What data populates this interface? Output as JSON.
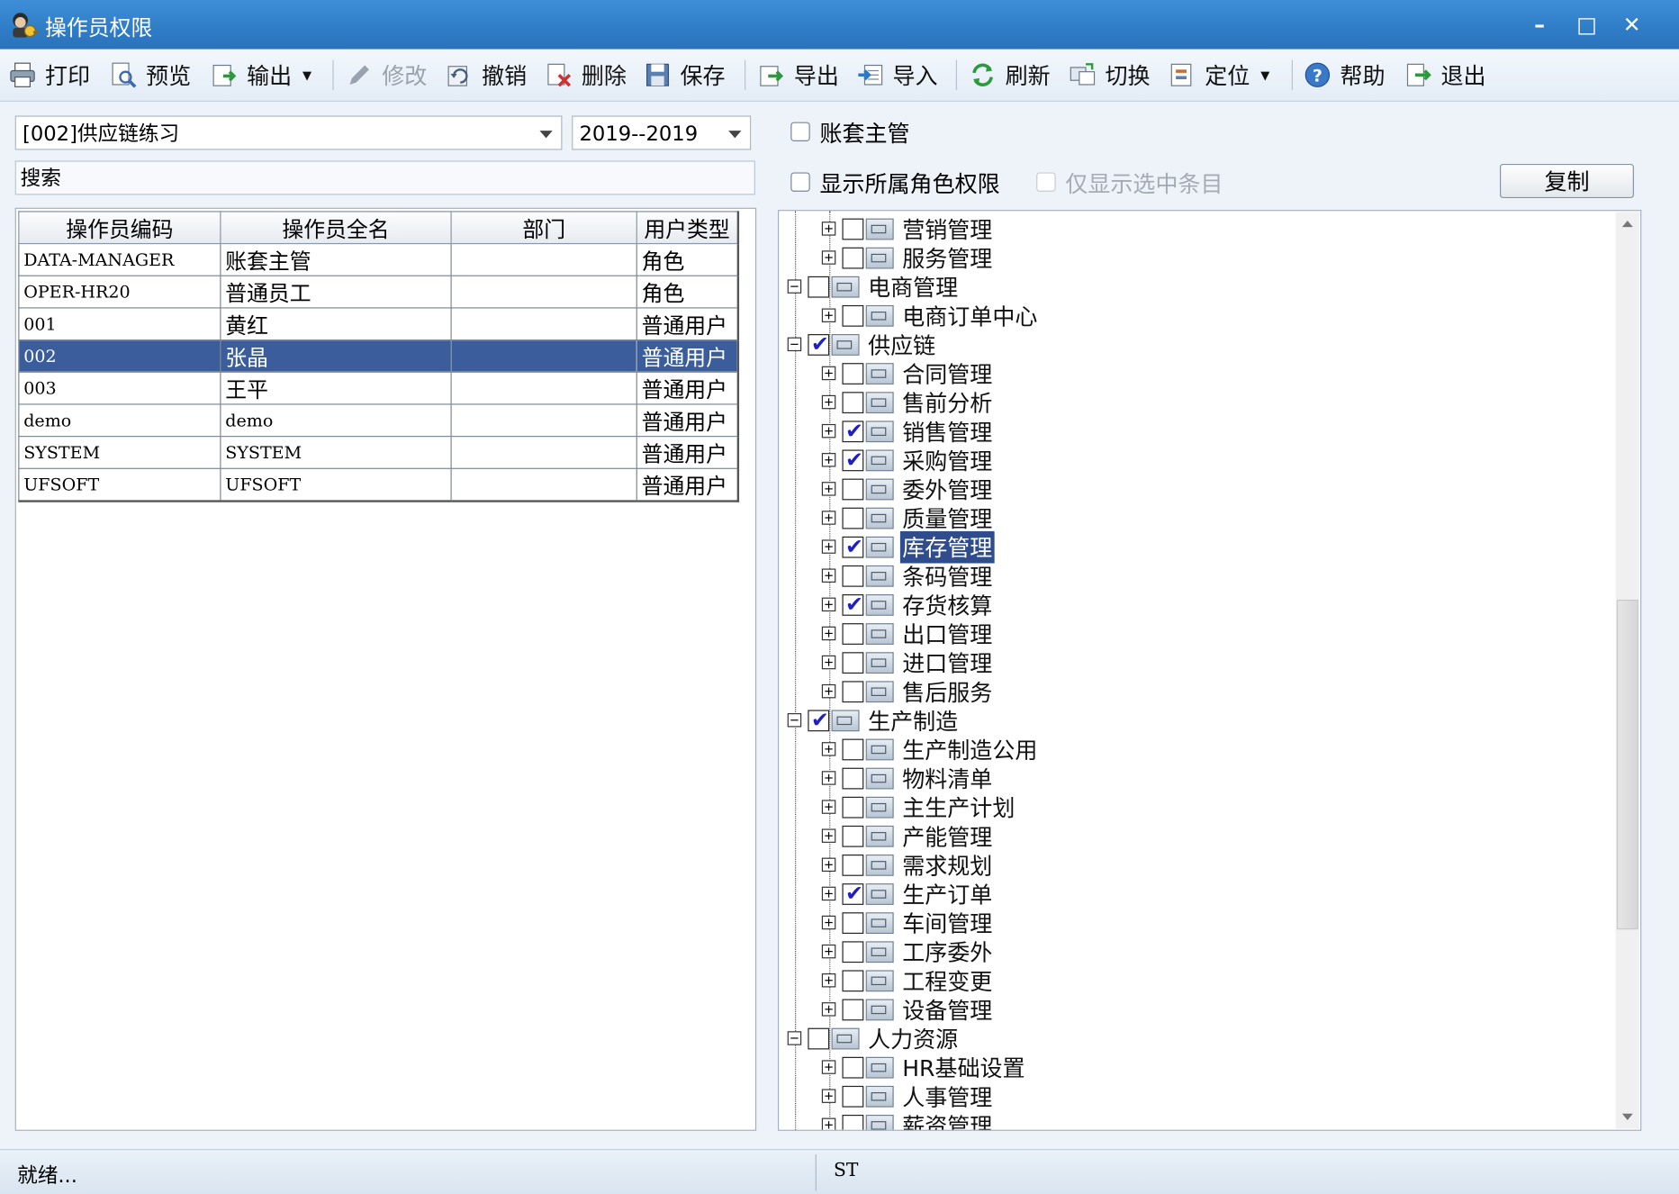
{
  "window": {
    "title": "操作员权限"
  },
  "window_buttons": {
    "minimize": "–",
    "maximize": "□",
    "close": "✕"
  },
  "toolbar": {
    "print": "打印",
    "preview": "预览",
    "output": "输出",
    "modify": "修改",
    "undo": "撤销",
    "delete": "删除",
    "save": "保存",
    "export": "导出",
    "import": "导入",
    "refresh": "刷新",
    "switch": "切换",
    "locate": "定位",
    "help": "帮助",
    "exit": "退出"
  },
  "filters": {
    "account": "[002]供应链练习",
    "year": "2019--2019",
    "search_placeholder": "搜索"
  },
  "options": {
    "account_supervisor": "账套主管",
    "show_role_permissions": "显示所属角色权限",
    "show_selected_only": "仅显示选中条目",
    "copy_button": "复制"
  },
  "table": {
    "headers": [
      "操作员编码",
      "操作员全名",
      "部门",
      "用户类型"
    ],
    "rows": [
      [
        "DATA-MANAGER",
        "账套主管",
        "",
        "角色"
      ],
      [
        "OPER-HR20",
        "普通员工",
        "",
        "角色"
      ],
      [
        "001",
        "黄红",
        "",
        "普通用户"
      ],
      [
        "002",
        "张晶",
        "",
        "普通用户"
      ],
      [
        "003",
        "王平",
        "",
        "普通用户"
      ],
      [
        "demo",
        "demo",
        "",
        "普通用户"
      ],
      [
        "SYSTEM",
        "SYSTEM",
        "",
        "普通用户"
      ],
      [
        "UFSOFT",
        "UFSOFT",
        "",
        "普通用户"
      ]
    ],
    "selected_row": 3
  },
  "tree": [
    {
      "label": "营销管理",
      "level": 1,
      "expanded": false,
      "checked": false
    },
    {
      "label": "服务管理",
      "level": 1,
      "expanded": false,
      "checked": false
    },
    {
      "label": "电商管理",
      "level": 0,
      "expanded": true,
      "checked": false
    },
    {
      "label": "电商订单中心",
      "level": 1,
      "expanded": false,
      "checked": false
    },
    {
      "label": "供应链",
      "level": 0,
      "expanded": true,
      "checked": true
    },
    {
      "label": "合同管理",
      "level": 1,
      "expanded": false,
      "checked": false
    },
    {
      "label": "售前分析",
      "level": 1,
      "expanded": false,
      "checked": false
    },
    {
      "label": "销售管理",
      "level": 1,
      "expanded": false,
      "checked": true
    },
    {
      "label": "采购管理",
      "level": 1,
      "expanded": false,
      "checked": true
    },
    {
      "label": "委外管理",
      "level": 1,
      "expanded": false,
      "checked": false
    },
    {
      "label": "质量管理",
      "level": 1,
      "expanded": false,
      "checked": false
    },
    {
      "label": "库存管理",
      "level": 1,
      "expanded": false,
      "checked": true,
      "selected": true
    },
    {
      "label": "条码管理",
      "level": 1,
      "expanded": false,
      "checked": false
    },
    {
      "label": "存货核算",
      "level": 1,
      "expanded": false,
      "checked": true
    },
    {
      "label": "出口管理",
      "level": 1,
      "expanded": false,
      "checked": false
    },
    {
      "label": "进口管理",
      "level": 1,
      "expanded": false,
      "checked": false
    },
    {
      "label": "售后服务",
      "level": 1,
      "expanded": false,
      "checked": false
    },
    {
      "label": "生产制造",
      "level": 0,
      "expanded": true,
      "checked": true
    },
    {
      "label": "生产制造公用",
      "level": 1,
      "expanded": false,
      "checked": false
    },
    {
      "label": "物料清单",
      "level": 1,
      "expanded": false,
      "checked": false
    },
    {
      "label": "主生产计划",
      "level": 1,
      "expanded": false,
      "checked": false
    },
    {
      "label": "产能管理",
      "level": 1,
      "expanded": false,
      "checked": false
    },
    {
      "label": "需求规划",
      "level": 1,
      "expanded": false,
      "checked": false
    },
    {
      "label": "生产订单",
      "level": 1,
      "expanded": false,
      "checked": true
    },
    {
      "label": "车间管理",
      "level": 1,
      "expanded": false,
      "checked": false
    },
    {
      "label": "工序委外",
      "level": 1,
      "expanded": false,
      "checked": false
    },
    {
      "label": "工程变更",
      "level": 1,
      "expanded": false,
      "checked": false
    },
    {
      "label": "设备管理",
      "level": 1,
      "expanded": false,
      "checked": false
    },
    {
      "label": "人力资源",
      "level": 0,
      "expanded": true,
      "checked": false
    },
    {
      "label": "HR基础设置",
      "level": 1,
      "expanded": false,
      "checked": false
    },
    {
      "label": "人事管理",
      "level": 1,
      "expanded": false,
      "checked": false
    },
    {
      "label": "薪资管理",
      "level": 1,
      "expanded": false,
      "checked": false
    }
  ],
  "status": {
    "message": "就绪...",
    "indicator": "ST"
  }
}
